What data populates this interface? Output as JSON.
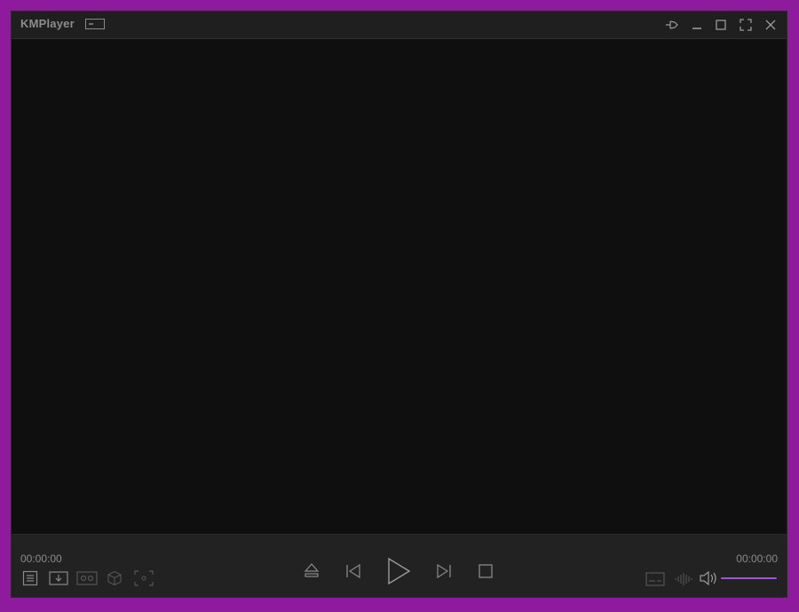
{
  "window": {
    "title": "KMPlayer"
  },
  "playback": {
    "current_time": "00:00:00",
    "total_time": "00:00:00",
    "volume_percent": 100
  },
  "icons": {
    "mini_mode": "mini-mode-icon",
    "pin": "pin-icon",
    "minimize": "minimize-icon",
    "maximize": "maximize-icon",
    "fullscreen": "fullscreen-icon",
    "close": "close-icon",
    "playlist": "playlist-icon",
    "download": "download-icon",
    "vr": "vr-icon",
    "3d": "cube-3d-icon",
    "capture": "capture-icon",
    "eject": "eject-icon",
    "previous": "previous-icon",
    "play": "play-icon",
    "next": "next-icon",
    "stop": "stop-icon",
    "subtitle": "subtitle-icon",
    "equalizer": "audio-wave-icon",
    "volume": "volume-icon"
  },
  "colors": {
    "frame": "#8e1a9e",
    "accent": "#9b59d0",
    "background": "#1c1c1c",
    "video": "#0f0f0f",
    "icon": "#8a8a8a"
  }
}
